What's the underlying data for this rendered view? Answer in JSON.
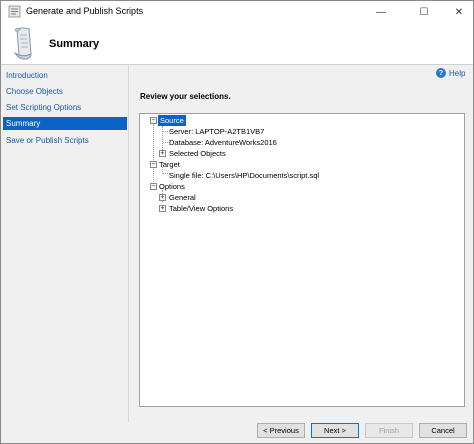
{
  "window": {
    "title": "Generate and Publish Scripts",
    "controls": {
      "minimize": "—",
      "maximize": "☐",
      "close": "✕"
    }
  },
  "header": {
    "heading": "Summary"
  },
  "nav": {
    "items": [
      {
        "label": "Introduction",
        "active": false
      },
      {
        "label": "Choose Objects",
        "active": false
      },
      {
        "label": "Set Scripting Options",
        "active": false
      },
      {
        "label": "Summary",
        "active": true
      },
      {
        "label": "Save or Publish Scripts",
        "active": false
      }
    ]
  },
  "content": {
    "help_label": "Help",
    "review_label": "Review your selections.",
    "tree": {
      "source": "Source",
      "server": "Server: LAPTOP-A2TB1VB7",
      "database": "Database: AdventureWorks2016",
      "selected_objects": "Selected Objects",
      "target": "Target",
      "single_file": "Single file: C:\\Users\\HP\\Documents\\script.sql",
      "options": "Options",
      "general": "General",
      "table_view_options": "Table/View Options"
    }
  },
  "footer": {
    "previous": "< Previous",
    "next": "Next >",
    "finish": "Finish",
    "cancel": "Cancel"
  },
  "colors": {
    "accent": "#0a64c8",
    "link": "#1a5aa8"
  }
}
